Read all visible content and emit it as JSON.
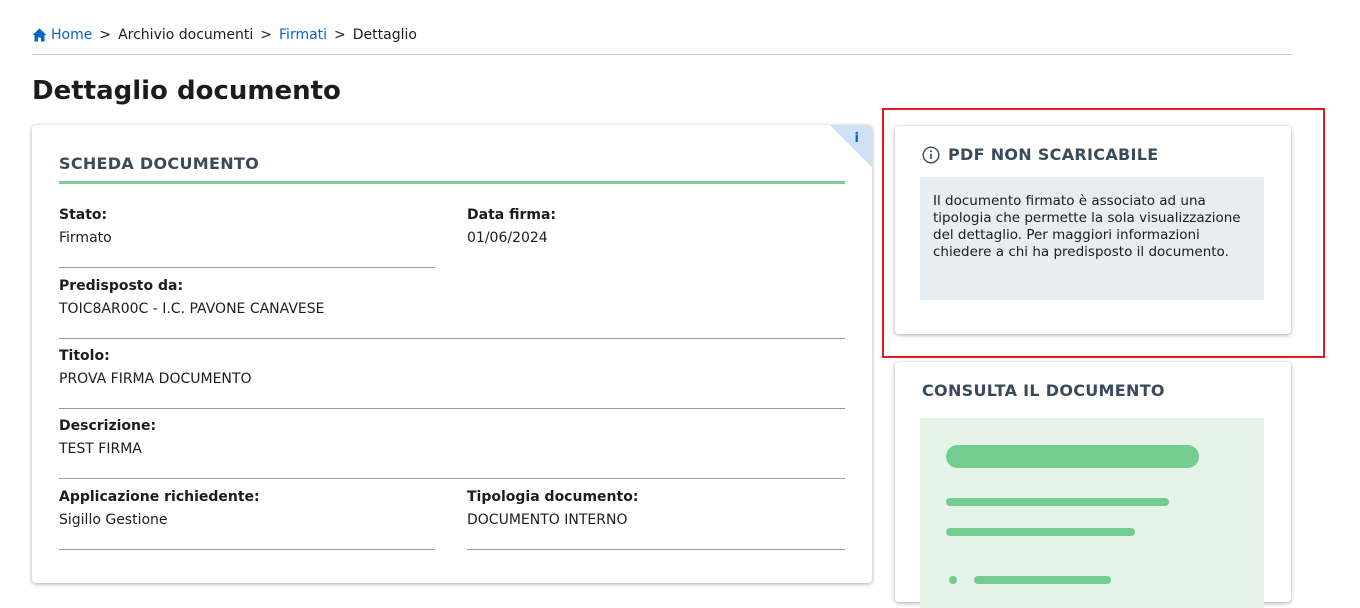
{
  "breadcrumb": {
    "home": "Home",
    "sep": ">",
    "archivio": "Archivio documenti",
    "firmati": "Firmati",
    "dettaglio": "Dettaglio"
  },
  "page_title": "Dettaglio documento",
  "scheda": {
    "corner_badge": "i",
    "title": "SCHEDA DOCUMENTO",
    "fields": {
      "stato": {
        "label": "Stato:",
        "value": "Firmato"
      },
      "data_firma": {
        "label": "Data firma:",
        "value": "01/06/2024"
      },
      "predisposto": {
        "label": "Predisposto da:",
        "value": "TOIC8AR00C - I.C. PAVONE CANAVESE"
      },
      "titolo": {
        "label": "Titolo:",
        "value": "PROVA FIRMA DOCUMENTO"
      },
      "descrizione": {
        "label": "Descrizione:",
        "value": "TEST FIRMA"
      },
      "applicazione": {
        "label": "Applicazione richiedente:",
        "value": "Sigillo Gestione"
      },
      "tipologia": {
        "label": "Tipologia documento:",
        "value": "DOCUMENTO INTERNO"
      }
    }
  },
  "pdf_notice": {
    "icon": "info-circle-icon",
    "title": "PDF NON SCARICABILE",
    "message": "Il documento firmato è associato ad una tipologia che permette la sola visualizzazione del dettaglio. Per maggiori informazioni chiedere a chi ha predisposto il documento."
  },
  "consulta": {
    "title": "CONSULTA IL DOCUMENTO"
  },
  "colors": {
    "link": "#0066cc",
    "accent_green": "#7fcc95",
    "highlight_red": "#e31b23",
    "notice_bg": "#e6edf3",
    "preview_bg": "#e4f4e8"
  }
}
